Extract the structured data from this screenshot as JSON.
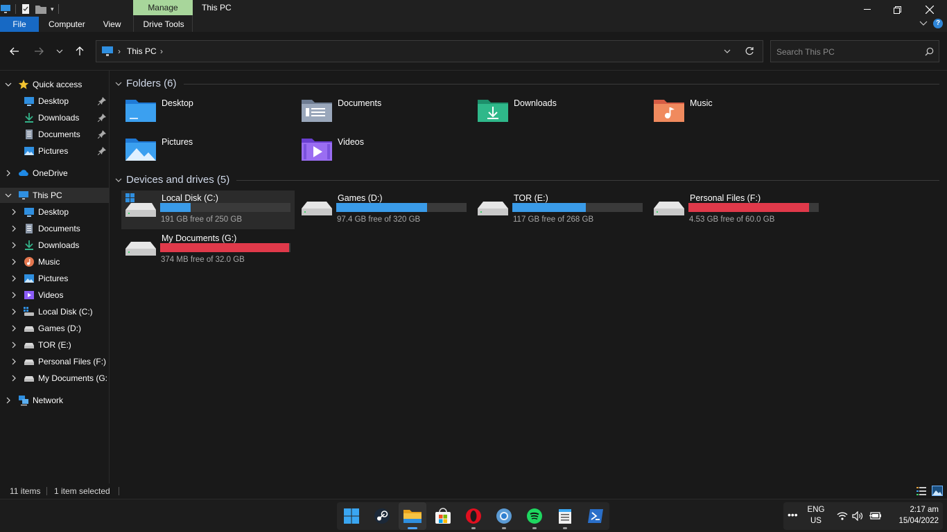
{
  "window": {
    "title": "This PC",
    "manage_label": "Manage",
    "drive_tools_label": "Drive Tools"
  },
  "ribbon": {
    "tabs": [
      "File",
      "Computer",
      "View",
      "Drive Tools"
    ],
    "accent": "#1769c4",
    "manage_color": "#a8d69b"
  },
  "address": {
    "path": "This PC",
    "search_placeholder": "Search This PC"
  },
  "sidebar": {
    "items": [
      {
        "label": "Quick access",
        "icon": "star-icon"
      },
      {
        "label": "Desktop",
        "icon": "desktop-icon",
        "pinned": true
      },
      {
        "label": "Downloads",
        "icon": "download-icon",
        "pinned": true
      },
      {
        "label": "Documents",
        "icon": "document-icon",
        "pinned": true
      },
      {
        "label": "Pictures",
        "icon": "pictures-icon",
        "pinned": true
      },
      {
        "label": "OneDrive",
        "icon": "cloud-icon"
      },
      {
        "label": "This PC",
        "icon": "computer-icon",
        "selected": true
      },
      {
        "label": "Desktop",
        "icon": "desktop-icon"
      },
      {
        "label": "Documents",
        "icon": "document-icon"
      },
      {
        "label": "Downloads",
        "icon": "download-icon"
      },
      {
        "label": "Music",
        "icon": "music-icon"
      },
      {
        "label": "Pictures",
        "icon": "pictures-icon"
      },
      {
        "label": "Videos",
        "icon": "videos-icon"
      },
      {
        "label": "Local Disk (C:)",
        "icon": "windows-drive-icon"
      },
      {
        "label": "Games (D:)",
        "icon": "drive-icon"
      },
      {
        "label": "TOR (E:)",
        "icon": "drive-icon"
      },
      {
        "label": "Personal Files (F:)",
        "icon": "drive-icon"
      },
      {
        "label": "My Documents (G:",
        "icon": "drive-icon"
      },
      {
        "label": "Network",
        "icon": "network-icon"
      }
    ]
  },
  "main": {
    "folders_header": "Folders (6)",
    "folders": [
      {
        "label": "Desktop",
        "icon": "desktop-folder-icon"
      },
      {
        "label": "Documents",
        "icon": "documents-folder-icon"
      },
      {
        "label": "Downloads",
        "icon": "downloads-folder-icon"
      },
      {
        "label": "Music",
        "icon": "music-folder-icon"
      },
      {
        "label": "Pictures",
        "icon": "pictures-folder-icon"
      },
      {
        "label": "Videos",
        "icon": "videos-folder-icon"
      }
    ],
    "drives_header": "Devices and drives (5)",
    "drives": [
      {
        "label": "Local Disk (C:)",
        "free_text": "191 GB free of 250 GB",
        "used_fraction": 0.236,
        "color": "#3a9be8",
        "selected": true
      },
      {
        "label": "Games (D:)",
        "free_text": "97.4 GB free of 320 GB",
        "used_fraction": 0.696,
        "color": "#3a9be8"
      },
      {
        "label": "TOR (E:)",
        "free_text": "117 GB free of 268 GB",
        "used_fraction": 0.563,
        "color": "#3a9be8"
      },
      {
        "label": "Personal Files (F:)",
        "free_text": "4.53 GB free of 60.0 GB",
        "used_fraction": 0.925,
        "color": "#e0394a"
      },
      {
        "label": "My Documents (G:)",
        "free_text": "374 MB free of 32.0 GB",
        "used_fraction": 0.989,
        "color": "#e0394a"
      }
    ]
  },
  "status": {
    "items_count": "11 items",
    "selection": "1 item selected"
  },
  "taskbar": {
    "apps": [
      "windows-start-icon",
      "steam-icon",
      "file-explorer-icon",
      "microsoft-store-icon",
      "opera-icon",
      "chrome-icon",
      "spotify-icon",
      "notepad-icon",
      "powershell-icon"
    ],
    "language_top": "ENG",
    "language_bottom": "US",
    "time": "2:17 am",
    "date": "15/04/2022"
  }
}
